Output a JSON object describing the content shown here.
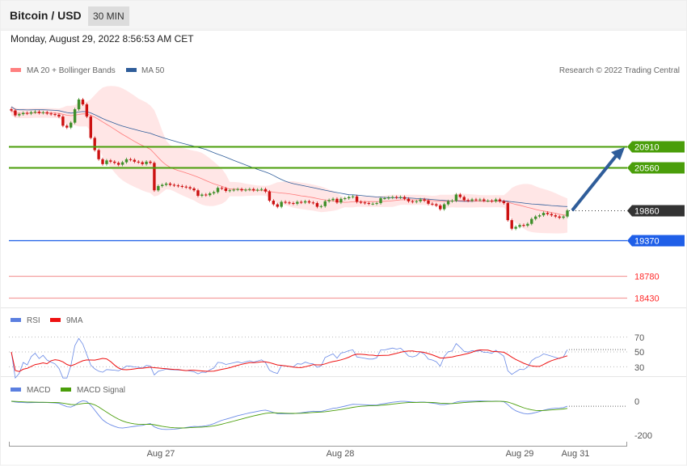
{
  "header": {
    "title": "Bitcoin / USD",
    "timeframe": "30 MIN",
    "datetime": "Monday, August 29, 2022 8:56:53 AM CET"
  },
  "legend": {
    "ma20": "MA 20 + Bollinger Bands",
    "ma50": "MA 50",
    "rsi": "RSI",
    "rsi_ma": "9MA",
    "macd": "MACD",
    "macd_signal": "MACD Signal",
    "credit": "Research © 2022 Trading Central"
  },
  "colors": {
    "up": "#3f8f2a",
    "down": "#cc1111",
    "ma20": "#ff7b7b",
    "ma50": "#2f5d9a",
    "band": "#ffe0e0",
    "resistance": "#4a9e0a",
    "pivot": "#333333",
    "support": "#1f5fe8",
    "support_low": "#ff2a2a"
  },
  "chart_data": [
    {
      "type": "candlestick",
      "title": "Bitcoin / USD 30 MIN",
      "closes": [
        21500,
        21420,
        21440,
        21460,
        21450,
        21470,
        21480,
        21460,
        21470,
        21450,
        21440,
        21430,
        21400,
        21250,
        21220,
        21300,
        21520,
        21680,
        21600,
        21400,
        21050,
        20850,
        20700,
        20620,
        20680,
        20660,
        20640,
        20610,
        20650,
        20700,
        20690,
        20660,
        20650,
        20620,
        20660,
        20640,
        20190,
        20260,
        20280,
        20300,
        20280,
        20270,
        20260,
        20250,
        20240,
        20220,
        20190,
        20100,
        20120,
        20110,
        20140,
        20160,
        20230,
        20220,
        20180,
        20190,
        20200,
        20210,
        20190,
        20200,
        20210,
        20190,
        20200,
        20210,
        20170,
        20020,
        19960,
        19920,
        20000,
        19990,
        19980,
        19970,
        20000,
        19990,
        20010,
        19990,
        19980,
        19920,
        19930,
        20010,
        20030,
        20050,
        19990,
        20050,
        20060,
        20080,
        20090,
        20000,
        19990,
        19980,
        19970,
        19970,
        19980,
        20060,
        20060,
        20070,
        20080,
        20070,
        20080,
        20050,
        20010,
        20000,
        20010,
        20040,
        20020,
        19970,
        19960,
        19940,
        19880,
        19960,
        20010,
        20020,
        20120,
        20080,
        20030,
        20020,
        20040,
        20030,
        20040,
        20020,
        20020,
        20010,
        20040,
        20010,
        19980,
        19700,
        19560,
        19590,
        19620,
        19610,
        19640,
        19720,
        19760,
        19780,
        19820,
        19800,
        19780,
        19760,
        19740,
        19760,
        19860
      ],
      "levels": [
        {
          "value": "20910",
          "kind": "resistance"
        },
        {
          "value": "20560",
          "kind": "resistance"
        },
        {
          "value": "19860",
          "kind": "pivot"
        },
        {
          "value": "19370",
          "kind": "support"
        },
        {
          "value": "18780",
          "kind": "support_low"
        },
        {
          "value": "18430",
          "kind": "support_low"
        }
      ],
      "target": 20910
    },
    {
      "type": "line",
      "title": "RSI",
      "yticks": [
        "70",
        "50",
        "30"
      ],
      "ylim": [
        20,
        80
      ]
    },
    {
      "type": "line",
      "title": "MACD",
      "yticks": [
        "0",
        "-200"
      ]
    },
    {
      "xticks": [
        "Aug 27",
        "Aug 28",
        "Aug 29",
        "Aug 31"
      ]
    }
  ]
}
